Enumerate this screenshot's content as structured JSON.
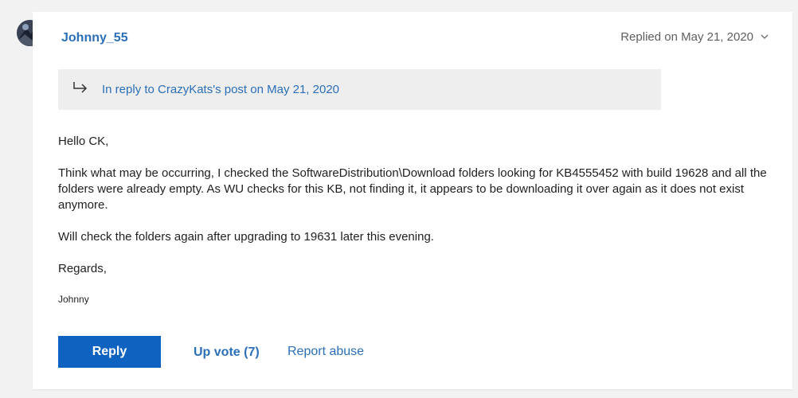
{
  "post": {
    "author": "Johnny_55",
    "replied_label": "Replied on May 21, 2020",
    "reply_to_text": "In reply to CrazyKats's post on May 21, 2020",
    "body": {
      "greeting": "Hello CK,",
      "paragraph1": "Think what may be occurring, I checked the SoftwareDistribution\\Download folders looking for KB4555452 with build 19628 and all the folders were already empty. As WU checks for this KB, not finding it, it appears to be downloading it over again as it does not exist anymore.",
      "paragraph2": "Will check the folders again after upgrading to 19631 later this evening.",
      "closing": "Regards,",
      "signature": "Johnny"
    }
  },
  "actions": {
    "reply_label": "Reply",
    "upvote_label": "Up vote (7)",
    "report_label": "Report abuse"
  },
  "icons": {
    "reply_arrow": "reply-arrow-icon",
    "chevron": "chevron-down-icon"
  },
  "colors": {
    "link": "#2a6fb8",
    "primary_button": "#1062c0",
    "background": "#f2f2f2"
  }
}
